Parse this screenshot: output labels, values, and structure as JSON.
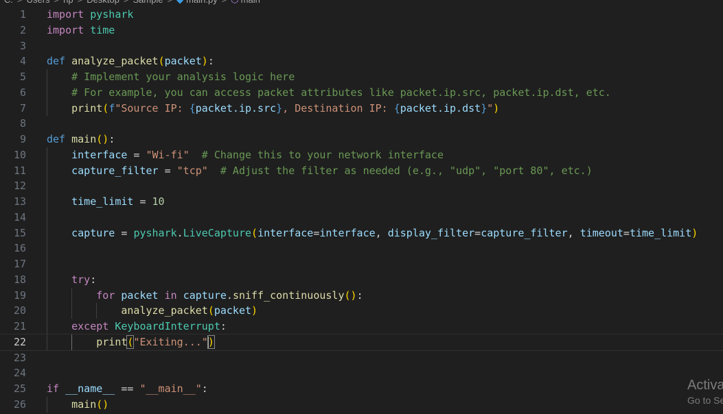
{
  "breadcrumb": {
    "items": [
      "C:",
      "Users",
      "hp",
      "Desktop",
      "Sample",
      "main.py",
      "main"
    ],
    "separator": ">"
  },
  "editor": {
    "active_line": 22,
    "lines": [
      {
        "n": "1",
        "tokens": [
          {
            "t": "import",
            "c": "ctl"
          },
          {
            "t": " "
          },
          {
            "t": "pyshark",
            "c": "cls"
          }
        ]
      },
      {
        "n": "2",
        "tokens": [
          {
            "t": "import",
            "c": "ctl"
          },
          {
            "t": " "
          },
          {
            "t": "time",
            "c": "cls"
          }
        ]
      },
      {
        "n": "3",
        "tokens": []
      },
      {
        "n": "4",
        "tokens": [
          {
            "t": "def",
            "c": "kw"
          },
          {
            "t": " "
          },
          {
            "t": "analyze_packet",
            "c": "fn"
          },
          {
            "t": "(",
            "c": "pb1"
          },
          {
            "t": "packet",
            "c": "var"
          },
          {
            "t": ")",
            "c": "pb1"
          },
          {
            "t": ":"
          }
        ]
      },
      {
        "n": "5",
        "guides": [
          1
        ],
        "tokens": [
          {
            "t": "    "
          },
          {
            "t": "# Implement your analysis logic here",
            "c": "cmt"
          }
        ]
      },
      {
        "n": "6",
        "guides": [
          1
        ],
        "tokens": [
          {
            "t": "    "
          },
          {
            "t": "# For example, you can access packet attributes like packet.ip.src, packet.ip.dst, etc.",
            "c": "cmt"
          }
        ]
      },
      {
        "n": "7",
        "guides": [
          1
        ],
        "tokens": [
          {
            "t": "    "
          },
          {
            "t": "print",
            "c": "fn"
          },
          {
            "t": "(",
            "c": "pb1"
          },
          {
            "t": "f",
            "c": "kw"
          },
          {
            "t": "\"Source IP: ",
            "c": "str"
          },
          {
            "t": "{",
            "c": "kw"
          },
          {
            "t": "packet.ip.src",
            "c": "var"
          },
          {
            "t": "}",
            "c": "kw"
          },
          {
            "t": ", Destination IP: ",
            "c": "str"
          },
          {
            "t": "{",
            "c": "kw"
          },
          {
            "t": "packet.ip.dst",
            "c": "var"
          },
          {
            "t": "}",
            "c": "kw"
          },
          {
            "t": "\"",
            "c": "str"
          },
          {
            "t": ")",
            "c": "pb1"
          }
        ]
      },
      {
        "n": "8",
        "tokens": []
      },
      {
        "n": "9",
        "tokens": [
          {
            "t": "def",
            "c": "kw"
          },
          {
            "t": " "
          },
          {
            "t": "main",
            "c": "fn"
          },
          {
            "t": "(",
            "c": "pb1"
          },
          {
            "t": ")",
            "c": "pb1"
          },
          {
            "t": ":"
          }
        ]
      },
      {
        "n": "10",
        "guides": [
          1
        ],
        "tokens": [
          {
            "t": "    "
          },
          {
            "t": "interface",
            "c": "var"
          },
          {
            "t": " = "
          },
          {
            "t": "\"Wi-fi\"",
            "c": "str"
          },
          {
            "t": "  "
          },
          {
            "t": "# Change this to your network interface",
            "c": "cmt"
          }
        ]
      },
      {
        "n": "11",
        "guides": [
          1
        ],
        "tokens": [
          {
            "t": "    "
          },
          {
            "t": "capture_filter",
            "c": "var"
          },
          {
            "t": " = "
          },
          {
            "t": "\"tcp\"",
            "c": "str"
          },
          {
            "t": "  "
          },
          {
            "t": "# Adjust the filter as needed (e.g., \"udp\", \"port 80\", etc.)",
            "c": "cmt"
          }
        ]
      },
      {
        "n": "12",
        "guides": [
          1
        ],
        "tokens": []
      },
      {
        "n": "13",
        "guides": [
          1
        ],
        "tokens": [
          {
            "t": "    "
          },
          {
            "t": "time_limit",
            "c": "var"
          },
          {
            "t": " = "
          },
          {
            "t": "10",
            "c": "num"
          }
        ]
      },
      {
        "n": "14",
        "guides": [
          1
        ],
        "tokens": []
      },
      {
        "n": "15",
        "guides": [
          1
        ],
        "tokens": [
          {
            "t": "    "
          },
          {
            "t": "capture",
            "c": "var"
          },
          {
            "t": " = "
          },
          {
            "t": "pyshark",
            "c": "cls"
          },
          {
            "t": "."
          },
          {
            "t": "LiveCapture",
            "c": "cls"
          },
          {
            "t": "(",
            "c": "pb1"
          },
          {
            "t": "interface",
            "c": "var"
          },
          {
            "t": "="
          },
          {
            "t": "interface",
            "c": "var"
          },
          {
            "t": ", "
          },
          {
            "t": "display_filter",
            "c": "var"
          },
          {
            "t": "="
          },
          {
            "t": "capture_filter",
            "c": "var"
          },
          {
            "t": ", "
          },
          {
            "t": "timeout",
            "c": "var"
          },
          {
            "t": "="
          },
          {
            "t": "time_limit",
            "c": "var"
          },
          {
            "t": ")",
            "c": "pb1"
          }
        ]
      },
      {
        "n": "16",
        "guides": [
          1
        ],
        "tokens": []
      },
      {
        "n": "17",
        "guides": [
          1
        ],
        "tokens": []
      },
      {
        "n": "18",
        "guides": [
          1
        ],
        "tokens": [
          {
            "t": "    "
          },
          {
            "t": "try",
            "c": "ctl"
          },
          {
            "t": ":"
          }
        ]
      },
      {
        "n": "19",
        "guides": [
          1,
          2
        ],
        "tokens": [
          {
            "t": "        "
          },
          {
            "t": "for",
            "c": "ctl"
          },
          {
            "t": " "
          },
          {
            "t": "packet",
            "c": "var"
          },
          {
            "t": " "
          },
          {
            "t": "in",
            "c": "ctl"
          },
          {
            "t": " "
          },
          {
            "t": "capture",
            "c": "var"
          },
          {
            "t": "."
          },
          {
            "t": "sniff_continuously",
            "c": "fn"
          },
          {
            "t": "(",
            "c": "pb1"
          },
          {
            "t": ")",
            "c": "pb1"
          },
          {
            "t": ":"
          }
        ]
      },
      {
        "n": "20",
        "guides": [
          1,
          2,
          3
        ],
        "tokens": [
          {
            "t": "            "
          },
          {
            "t": "analyze_packet",
            "c": "fn"
          },
          {
            "t": "(",
            "c": "pb1"
          },
          {
            "t": "packet",
            "c": "var"
          },
          {
            "t": ")",
            "c": "pb1"
          }
        ]
      },
      {
        "n": "21",
        "guides": [
          1
        ],
        "tokens": [
          {
            "t": "    "
          },
          {
            "t": "except",
            "c": "ctl"
          },
          {
            "t": " "
          },
          {
            "t": "KeyboardInterrupt",
            "c": "cls"
          },
          {
            "t": ":"
          }
        ]
      },
      {
        "n": "22",
        "guides": [
          1,
          "2a"
        ],
        "tokens": [
          {
            "t": "        "
          },
          {
            "t": "print",
            "c": "fn"
          },
          {
            "t": "(",
            "c": "pb1 bmatch"
          },
          {
            "t": "\"Exiting...\"",
            "c": "str"
          },
          {
            "cursor": true
          },
          {
            "t": ")",
            "c": "pb1 bmatch"
          }
        ]
      },
      {
        "n": "23",
        "tokens": []
      },
      {
        "n": "24",
        "tokens": []
      },
      {
        "n": "25",
        "tokens": [
          {
            "t": "if",
            "c": "ctl"
          },
          {
            "t": " "
          },
          {
            "t": "__name__",
            "c": "var"
          },
          {
            "t": " == "
          },
          {
            "t": "\"__main__\"",
            "c": "str"
          },
          {
            "t": ":"
          }
        ]
      },
      {
        "n": "26",
        "guides": [
          1
        ],
        "tokens": [
          {
            "t": "    "
          },
          {
            "t": "main",
            "c": "fn"
          },
          {
            "t": "(",
            "c": "pb1"
          },
          {
            "t": ")",
            "c": "pb1"
          }
        ]
      }
    ]
  },
  "watermark": {
    "line1": "Activa",
    "line2": "Go to Se"
  }
}
